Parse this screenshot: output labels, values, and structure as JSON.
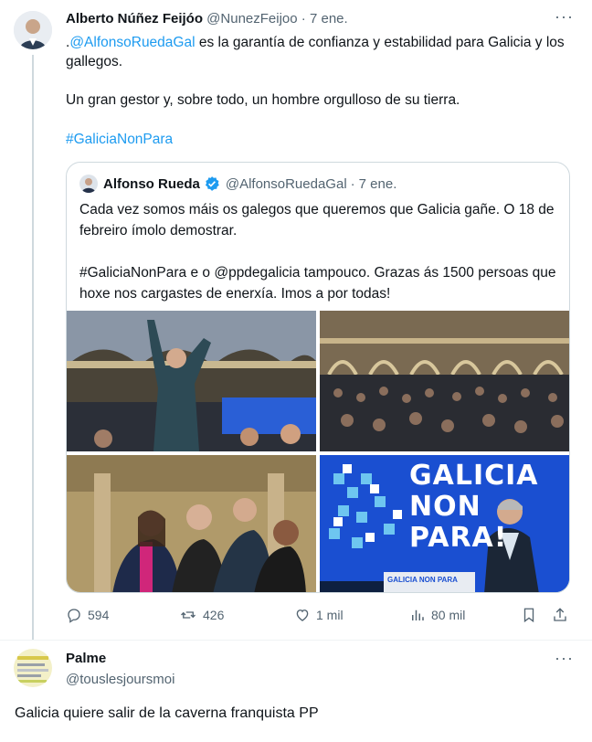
{
  "tweet": {
    "author_name": "Alberto Núñez Feijóo",
    "author_handle": "@NunezFeijoo",
    "separator": "·",
    "date": "7 ene.",
    "text_prefix": ".",
    "mention": "@AlfonsoRuedaGal",
    "text_rest": " es la garantía de confianza y estabilidad para Galicia y los gallegos.",
    "paragraph2": "Un gran gestor y, sobre todo, un hombre orgulloso de su tierra.",
    "hashtag": "#GaliciaNonPara",
    "more_label": "···"
  },
  "quote": {
    "author_name": "Alfonso Rueda",
    "author_handle": "@AlfonsoRuedaGal",
    "separator": "·",
    "date": "7 ene.",
    "paragraph1": "Cada vez somos máis os galegos que queremos que Galicia gañe. O 18 de febreiro ímolo demostrar.",
    "paragraph2": "#GaliciaNonPara e o @ppdegalicia tampouco. Grazas ás 1500 persoas que hoxe nos cargastes de enerxía. Imos a por todas!",
    "banner_line1": "GALICIA",
    "banner_line2": "NON",
    "banner_line3": "PARA!",
    "lectern_text": "GALICIA NON PARA"
  },
  "actions": {
    "replies": "594",
    "retweets": "426",
    "likes": "1 mil",
    "views": "80 mil"
  },
  "reply": {
    "author_name": "Palme",
    "author_handle": "@touslesjoursmoi",
    "text": "Galicia quiere salir de la caverna franquista PP",
    "more_label": "···"
  },
  "colors": {
    "link": "#1d9bf0",
    "secondary_text": "#536471",
    "border": "#cfd9de",
    "banner_blue": "#1a4fd1"
  },
  "icons": [
    "reply-icon",
    "retweet-icon",
    "like-icon",
    "views-icon",
    "bookmark-icon",
    "share-icon",
    "verified-icon",
    "more-icon"
  ]
}
